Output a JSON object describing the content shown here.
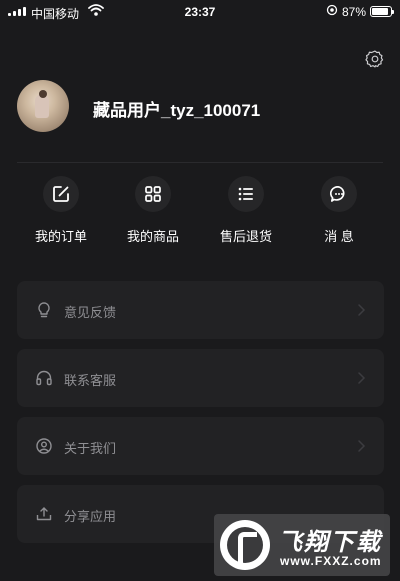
{
  "status_bar": {
    "carrier": "中国移动",
    "time": "23:37",
    "battery": "87%",
    "battery_level": 0.87
  },
  "profile": {
    "username": "藏品用户_tyz_100071",
    "settings_icon": "gear-icon"
  },
  "shortcuts": [
    {
      "label": "我的订单",
      "icon": "edit-order-icon"
    },
    {
      "label": "我的商品",
      "icon": "grid-icon"
    },
    {
      "label": "售后退货",
      "icon": "list-icon"
    },
    {
      "label": "消 息",
      "icon": "message-icon"
    }
  ],
  "menu": [
    {
      "label": "意见反馈",
      "icon": "lightbulb-icon"
    },
    {
      "label": "联系客服",
      "icon": "headphones-icon"
    },
    {
      "label": "关于我们",
      "icon": "user-circle-icon"
    },
    {
      "label": "分享应用",
      "icon": "share-upload-icon"
    }
  ],
  "watermark": {
    "title": "飞翔下载",
    "url": "www.FXXZ.com"
  },
  "colors": {
    "background": "#1a1a1c",
    "card": "#222224",
    "icon_circle": "#262628",
    "muted_text": "#8f8f93"
  }
}
